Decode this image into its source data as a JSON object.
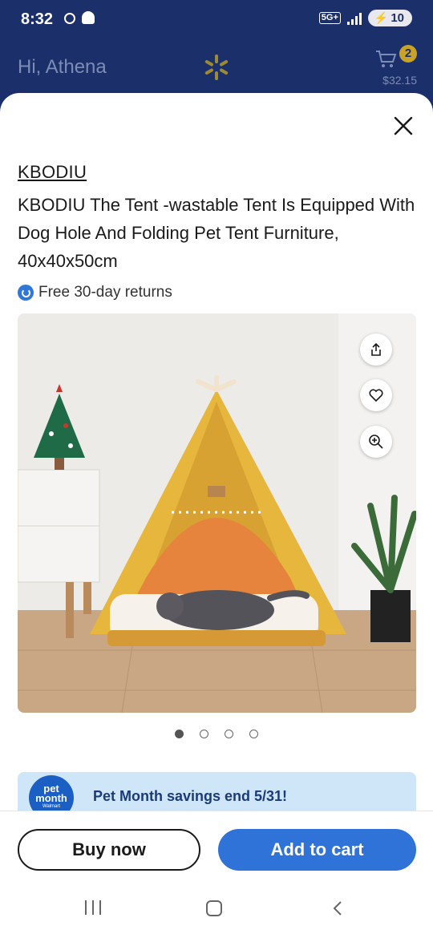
{
  "status_bar": {
    "time": "8:32",
    "network": "5G+",
    "battery": "10"
  },
  "header": {
    "greeting": "Hi, Athena",
    "cart_count": "2",
    "cart_total": "$32.15"
  },
  "product": {
    "brand": "KBODIU",
    "title": "KBODIU The Tent -wastable Tent Is Equipped With Dog Hole And Folding Pet Tent Furniture, 40x40x50cm",
    "returns_text": "Free 30-day returns",
    "image_count": 4,
    "active_image_index": 0
  },
  "image_actions": {
    "share_icon": "share-icon",
    "favorite_icon": "heart-icon",
    "zoom_icon": "zoom-in-icon"
  },
  "promo": {
    "badge_line1": "pet",
    "badge_line2": "month",
    "badge_line3": "Walmart",
    "text": "Pet Month savings end 5/31!"
  },
  "actions": {
    "buy_now": "Buy now",
    "add_to_cart": "Add to cart"
  },
  "colors": {
    "header_bg": "#1b2f6b",
    "accent_blue": "#2f73d9",
    "promo_bg": "#cfe6f8",
    "cart_badge": "#c9a227"
  }
}
